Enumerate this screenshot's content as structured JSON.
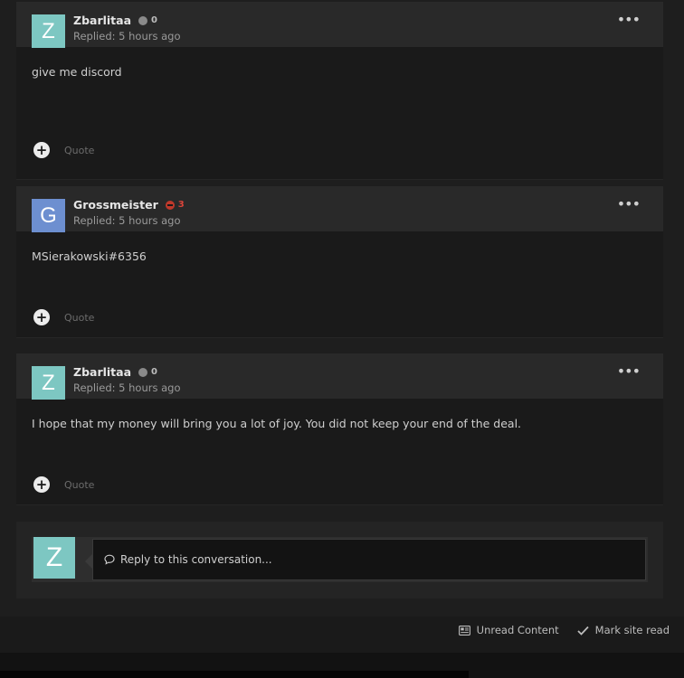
{
  "posts": [
    {
      "avatar_letter": "Z",
      "avatar_color": "#7dc7c2",
      "author": "Zbarlitaa",
      "reputation": "0",
      "reputation_type": "neutral",
      "reply_time": "Replied: 5 hours ago",
      "body": "give me discord",
      "quote_label": "Quote"
    },
    {
      "avatar_letter": "G",
      "avatar_color": "#6d8fd0",
      "author": "Grossmeister",
      "reputation": "3",
      "reputation_type": "negative",
      "reply_time": "Replied: 5 hours ago",
      "body": "MSierakowski#6356",
      "quote_label": "Quote"
    },
    {
      "avatar_letter": "Z",
      "avatar_color": "#7dc7c2",
      "author": "Zbarlitaa",
      "reputation": "0",
      "reputation_type": "neutral",
      "reply_time": "Replied: 5 hours ago",
      "body": "I hope that my money will bring you a lot of joy. You did not keep your end of the deal.",
      "quote_label": "Quote"
    }
  ],
  "reply": {
    "avatar_letter": "Z",
    "placeholder": "Reply to this conversation..."
  },
  "footer": {
    "unread_content": "Unread Content",
    "mark_site_read": "Mark site read"
  }
}
